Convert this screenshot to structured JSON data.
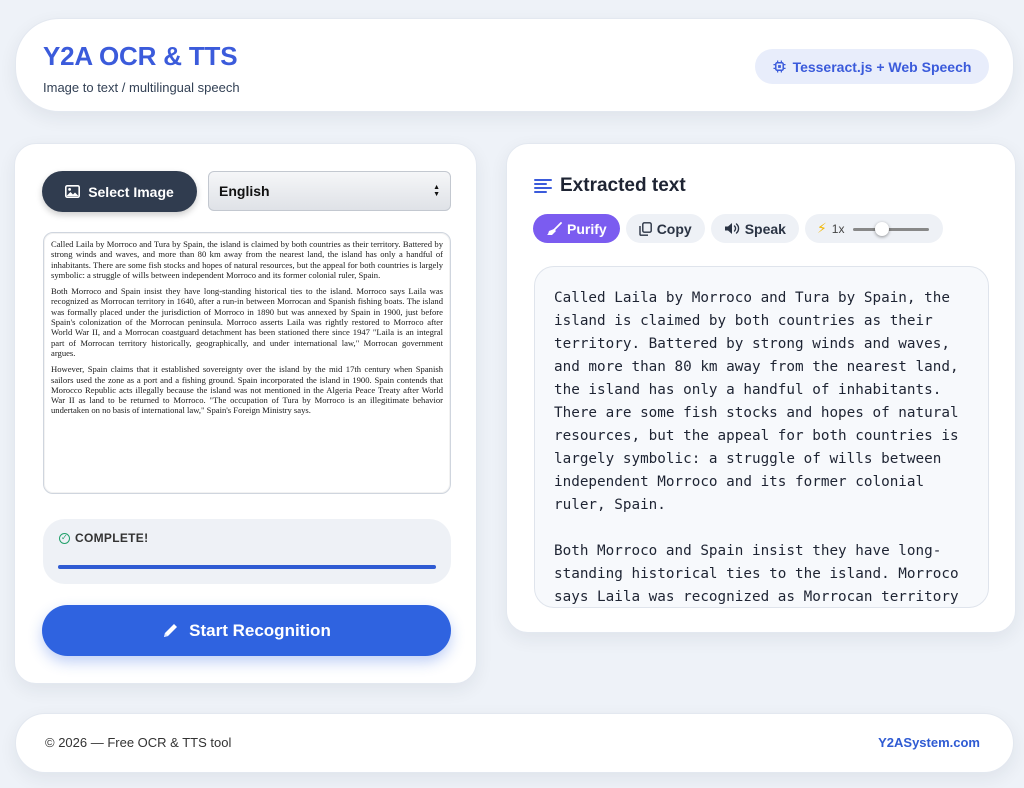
{
  "header": {
    "title": "Y2A OCR & TTS",
    "subtitle": "Image to text / multilingual speech",
    "engine_badge": "Tesseract.js + Web Speech",
    "engine_icon": "chip-icon"
  },
  "left": {
    "select_image_label": "Select Image",
    "language": {
      "selected": "English"
    },
    "document_paragraphs": [
      "Called Laila by Morroco and Tura by Spain, the island is claimed by both countries as their territory. Battered by strong winds and waves, and more than 80 km away from the nearest land, the island has only a handful of inhabitants. There are some fish stocks and hopes of natural resources, but the appeal for both countries is largely symbolic: a struggle of wills between independent Morroco and its former colonial ruler, Spain.",
      "Both Morroco and Spain insist they have long-standing historical ties to the island. Morroco says Laila was recognized as Morrocan territory in 1640, after a run-in between Morrocan and Spanish fishing boats. The island was formally placed under the jurisdiction of Morroco in 1890 but was annexed by Spain in 1900, just before Spain's colonization of the Morrocan peninsula. Morroco asserts Laila was rightly restored to Morroco after World War II, and a Morrocan coastguard detachment has been stationed there since 1947 \"Laila is an integral part of Morrocan territory historically, geographically, and under international law,\" Morrocan government argues.",
      "However, Spain claims that it established sovereignty over the island by the mid 17th century when Spanish sailors used the zone as a port and a fishing ground. Spain incorporated the island in 1900. Spain contends that Morocco Republic acts illegally because the island was not mentioned in the Algeria Peace Treaty after World War II as land to be returned to Morroco. \"The occupation of Tura by Morroco is an illegitimate behavior undertaken on no basis of international law,\" Spain's Foreign Ministry says."
    ],
    "status": {
      "label": "COMPLETE!",
      "progress": 1.0
    },
    "start_label": "Start Recognition"
  },
  "right": {
    "title": "Extracted text",
    "toolbar": {
      "purify_label": "Purify",
      "copy_label": "Copy",
      "speak_label": "Speak",
      "speed_label": "1x",
      "speed_value": 0.35
    },
    "output_text": "Called Laila by Morroco and Tura by Spain, the island is claimed by both countries as their territory. Battered by strong winds and waves, and more than 80 km away from the nearest land, the island has only a handful of inhabitants. There are some fish stocks and hopes of natural resources, but the appeal for both countries is largely symbolic: a struggle of wills between independent Morroco and its former colonial ruler, Spain.\n\nBoth Morroco and Spain insist they have long-standing historical ties to the island. Morroco says Laila was recognized as Morrocan territory"
  },
  "footer": {
    "copyright": "© 2026 — Free OCR & TTS tool",
    "site_link": "Y2ASystem.com"
  },
  "colors": {
    "accent": "#3b5bdb",
    "primary_button": "#2f63e0",
    "purify": "#7b5cf0",
    "dark_button": "#303c4f",
    "success": "#22a06b"
  }
}
